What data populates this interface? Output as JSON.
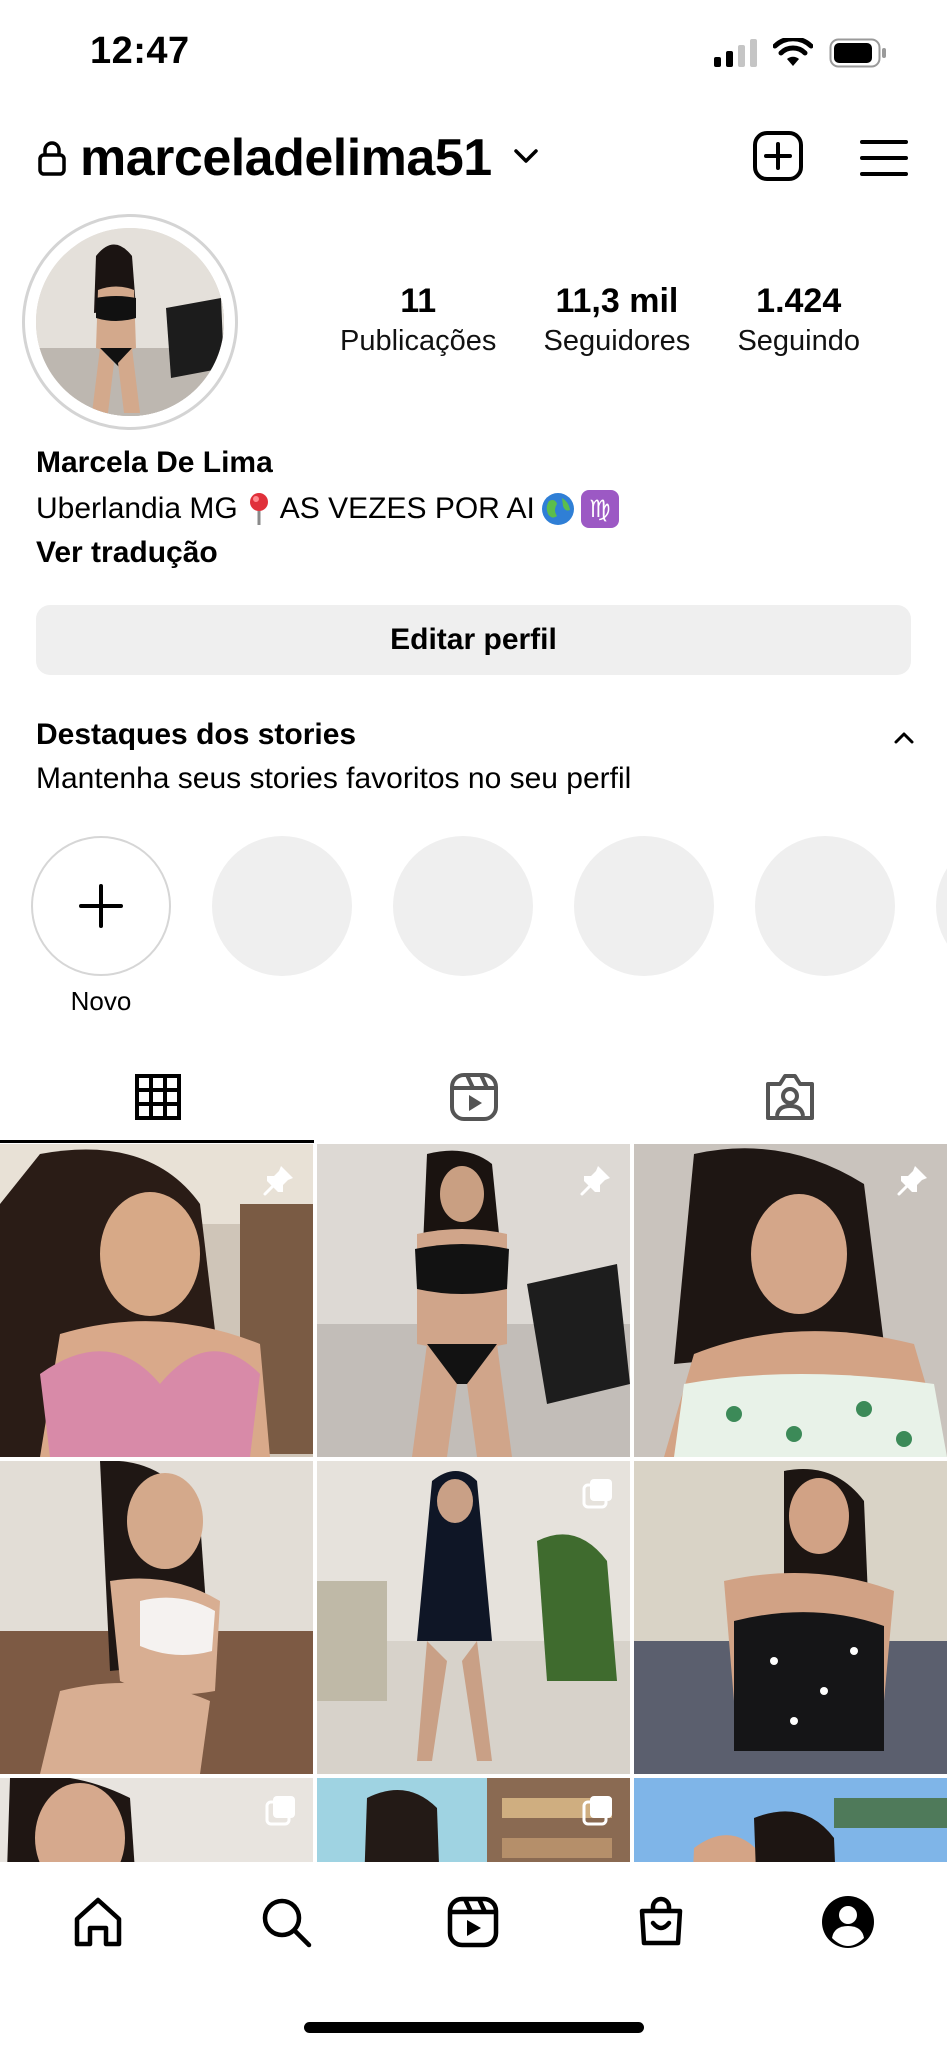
{
  "status_bar": {
    "time": "12:47"
  },
  "header": {
    "username": "marceladelima51"
  },
  "profile": {
    "stats": [
      {
        "value": "11",
        "label": "Publicações"
      },
      {
        "value": "11,3 mil",
        "label": "Seguidores"
      },
      {
        "value": "1.424",
        "label": "Seguindo"
      }
    ],
    "name": "Marcela De Lima",
    "bio_city": "Uberlandia MG",
    "bio_tagline": "AS VEZES POR AI",
    "translate_link": "Ver tradução",
    "edit_button": "Editar perfil"
  },
  "highlights": {
    "title": "Destaques dos stories",
    "subtitle": "Mantenha seus stories favoritos no seu perfil",
    "new_label": "Novo"
  },
  "tabs": [
    {
      "icon": "grid-icon",
      "active": true
    },
    {
      "icon": "reels-icon",
      "active": false
    },
    {
      "icon": "tagged-icon",
      "active": false
    }
  ],
  "grid": [
    {
      "badge": "pin"
    },
    {
      "badge": "pin"
    },
    {
      "badge": "pin"
    },
    {
      "badge": "none"
    },
    {
      "badge": "multi"
    },
    {
      "badge": "none"
    },
    {
      "badge": "multi"
    },
    {
      "badge": "multi"
    },
    {
      "badge": "none"
    }
  ],
  "bottom_nav": [
    "home-icon",
    "search-icon",
    "reels-icon",
    "shop-icon",
    "profile-icon"
  ],
  "colors": {
    "button_bg": "#efefef",
    "placeholder": "#efefef",
    "virgo_bg": "#9c59c4"
  }
}
